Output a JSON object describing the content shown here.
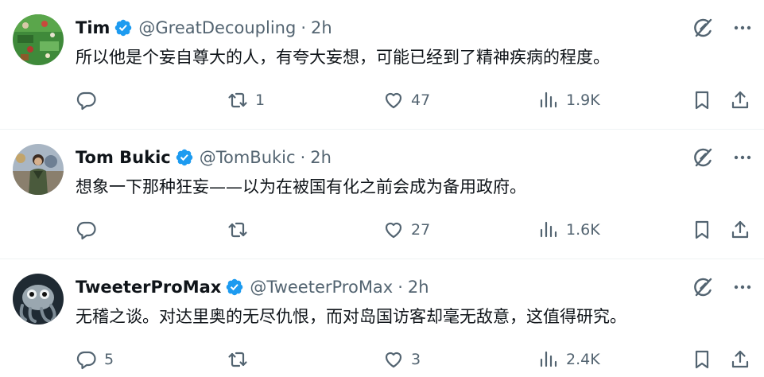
{
  "tweets": [
    {
      "name": "Tim",
      "handle": "@GreatDecoupling",
      "separator": "·",
      "time": "2h",
      "text": "所以他是个妄自尊大的人，有夸大妄想，可能已经到了精神疾病的程度。",
      "replies": "",
      "retweets": "1",
      "likes": "47",
      "views": "1.9K"
    },
    {
      "name": "Tom Bukic",
      "handle": "@TomBukic",
      "separator": "·",
      "time": "2h",
      "text": "想象一下那种狂妄——以为在被国有化之前会成为备用政府。",
      "replies": "",
      "retweets": "",
      "likes": "27",
      "views": "1.6K"
    },
    {
      "name": "TweeterProMax",
      "handle": "@TweeterProMax",
      "separator": "·",
      "time": "2h",
      "text": "无稽之谈。对达里奥的无尽仇恨，而对岛国访客却毫无敌意，这值得研究。",
      "replies": "5",
      "retweets": "",
      "likes": "3",
      "views": "2.4K"
    }
  ],
  "colors": {
    "text": "#0f1419",
    "secondary": "#536471",
    "verified": "#1d9bf0",
    "divider": "#eff3f4"
  },
  "icons": [
    "verified-badge-icon",
    "grok-icon",
    "more-icon",
    "reply-icon",
    "retweet-icon",
    "like-icon",
    "views-icon",
    "bookmark-icon",
    "share-icon"
  ]
}
